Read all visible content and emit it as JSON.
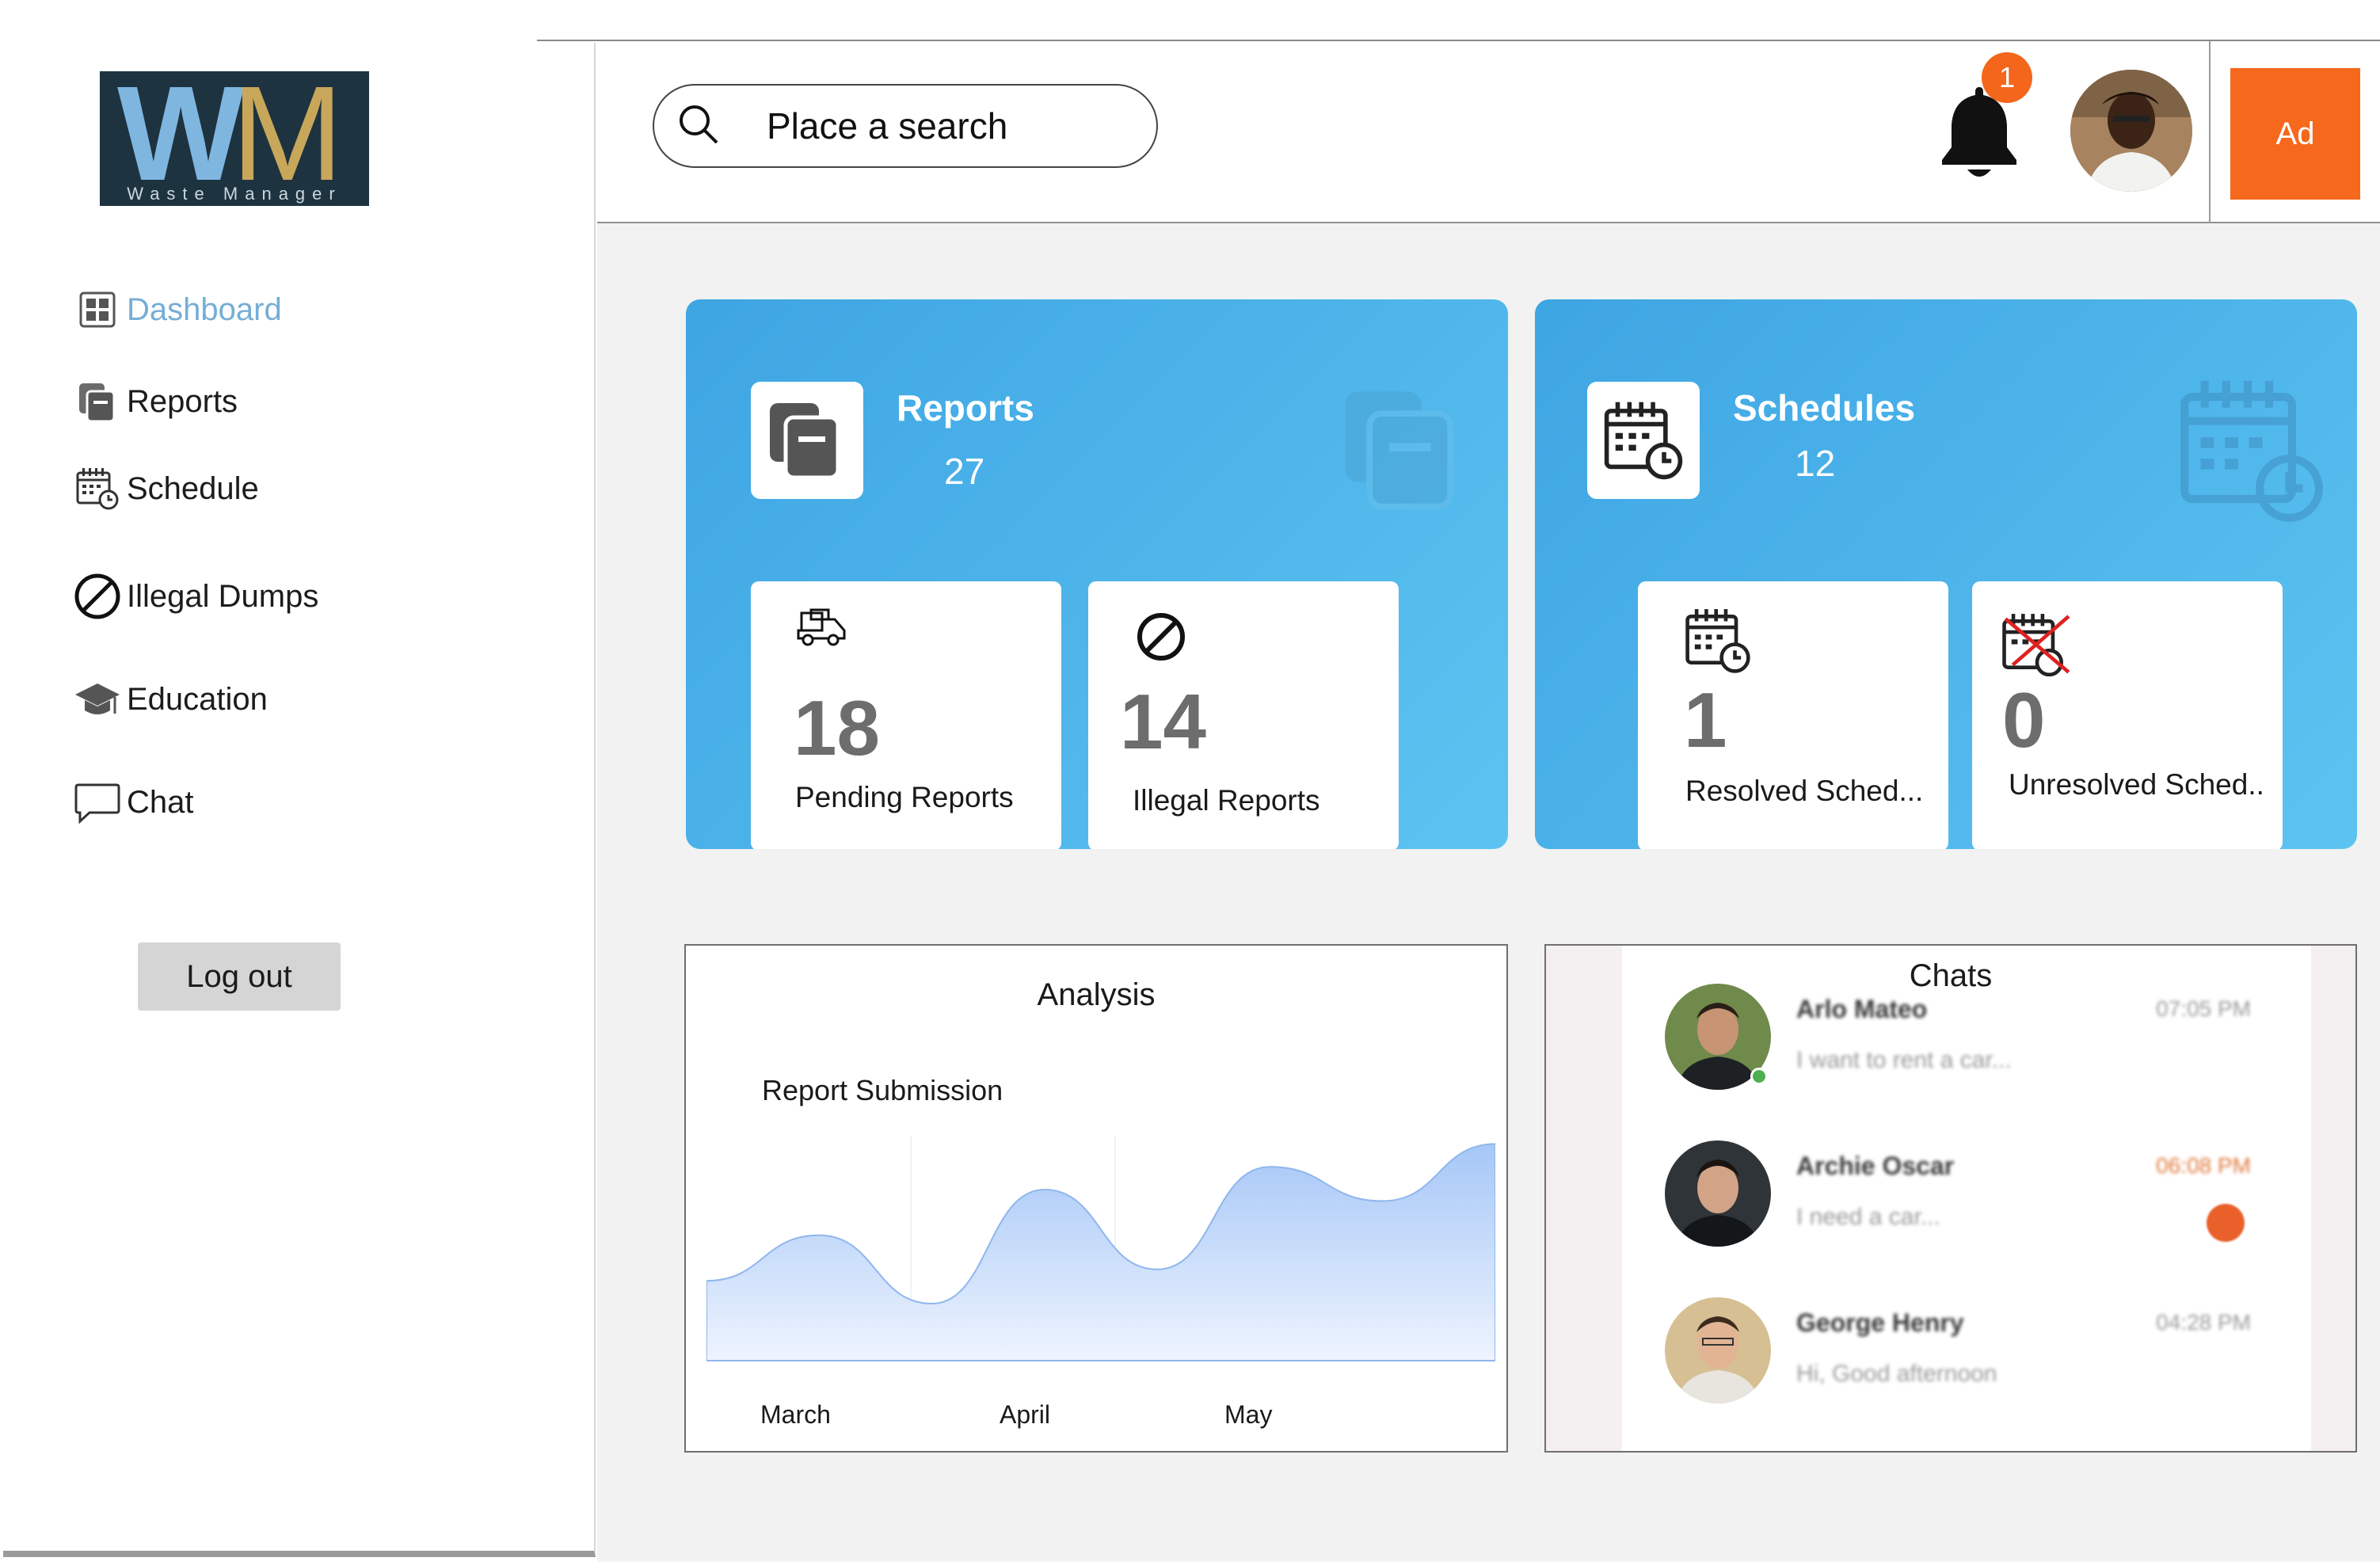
{
  "brand": {
    "logo_letters": "WM",
    "logo_w": "W",
    "logo_m": "M",
    "logo_tagline": "Waste Manager"
  },
  "sidebar": {
    "items": [
      {
        "label": "Dashboard",
        "icon": "dashboard-grid-icon",
        "active": true
      },
      {
        "label": "Reports",
        "icon": "reports-copy-icon",
        "active": false
      },
      {
        "label": "Schedule",
        "icon": "calendar-clock-icon",
        "active": false
      },
      {
        "label": "Illegal Dumps",
        "icon": "prohibited-icon",
        "active": false
      },
      {
        "label": "Education",
        "icon": "graduation-cap-icon",
        "active": false
      },
      {
        "label": "Chat",
        "icon": "chat-bubble-icon",
        "active": false
      }
    ],
    "logout_label": "Log out"
  },
  "topbar": {
    "search_placeholder": "Place a search",
    "notification_count": "1",
    "ad_label": "Ad"
  },
  "reports_card": {
    "title": "Reports",
    "count": "27",
    "stats": [
      {
        "value": "18",
        "label": "Pending Reports",
        "icon": "truck-icon"
      },
      {
        "value": "14",
        "label": "Illegal Reports",
        "icon": "prohibited-icon"
      }
    ]
  },
  "schedules_card": {
    "title": "Schedules",
    "count": "12",
    "stats": [
      {
        "value": "1",
        "label": "Resolved Sched...",
        "icon": "calendar-clock-icon"
      },
      {
        "value": "0",
        "label": "Unresolved Sched..",
        "icon": "calendar-crossed-icon"
      }
    ]
  },
  "analysis": {
    "title": "Analysis",
    "subtitle": "Report Submission",
    "x_labels": [
      "March",
      "April",
      "May"
    ]
  },
  "chart_data": {
    "type": "area",
    "title": "Report Submission",
    "categories": [
      "March",
      "April",
      "May"
    ],
    "series": [
      {
        "values": [
          0.35,
          0.55,
          0.25,
          0.75,
          0.4,
          0.85,
          0.7,
          0.95
        ]
      }
    ],
    "grid": false,
    "colors": {
      "fill_top": "#a8c8f8",
      "fill_bottom": "#eaf1fe"
    }
  },
  "chats": {
    "title": "Chats",
    "items": [
      {
        "name": "Arlo Mateo",
        "message": "I want to rent a car...",
        "time": "07:05 PM",
        "online": true,
        "unread": false
      },
      {
        "name": "Archie Oscar",
        "message": "I need a car...",
        "time": "06:08 PM",
        "online": false,
        "unread": true
      },
      {
        "name": "George Henry",
        "message": "Hi, Good afternoon",
        "time": "04:28 PM",
        "online": false,
        "unread": false
      }
    ]
  },
  "colors": {
    "accent_blue": "#3ea5e3",
    "accent_orange": "#f4661b",
    "active_nav": "#75aed6"
  }
}
